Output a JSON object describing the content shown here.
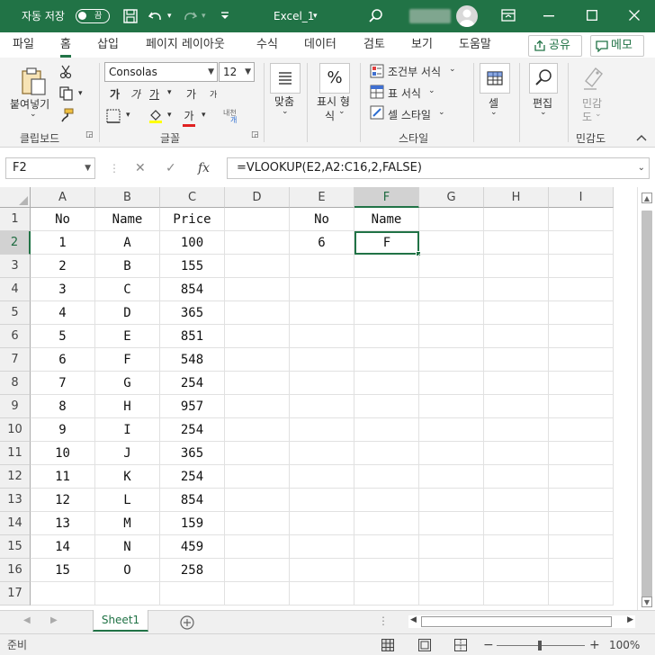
{
  "colors": {
    "accent": "#217346",
    "header_bg": "#f0f0f0",
    "active_border": "#217346"
  },
  "titlebar": {
    "autosave_label": "자동 저장",
    "autosave_state": "끔",
    "doc_title": "Excel_1",
    "icons": [
      "save-icon",
      "undo-icon",
      "redo-icon",
      "customize-icon",
      "search-icon",
      "user-icon",
      "ribbon-options-icon",
      "minimize-icon",
      "maximize-icon",
      "close-icon"
    ]
  },
  "tabs": {
    "items": [
      "파일",
      "홈",
      "삽입",
      "페이지 레이아웃",
      "수식",
      "데이터",
      "검토",
      "보기",
      "도움말"
    ],
    "active": "홈",
    "share_label": "공유",
    "memo_label": "메모"
  },
  "ribbon": {
    "clipboard": {
      "paste_label": "붙여넣기",
      "group": "클립보드"
    },
    "font": {
      "family": "Consolas",
      "size": "12",
      "group": "글꼴",
      "bold": "가",
      "italic": "가",
      "underline": "가",
      "grow": "가",
      "shrink": "가",
      "fill": "가",
      "color": "가",
      "phonetic": "내천"
    },
    "alignment": {
      "label": "맞춤"
    },
    "number": {
      "label_line1": "표시 형",
      "label_line2": "식",
      "symbol": "%"
    },
    "styles": {
      "cond_format": "조건부 서식",
      "table_format": "표 서식",
      "cell_styles": "셀 스타일",
      "group": "스타일"
    },
    "cells": {
      "label": "셀"
    },
    "editing": {
      "label": "편집"
    },
    "sensitivity": {
      "label_line1": "민감",
      "label_line2": "도",
      "group": "민감도"
    }
  },
  "formula_bar": {
    "name_box": "F2",
    "formula": "=VLOOKUP(E2,A2:C16,2,FALSE)"
  },
  "sheet": {
    "columns": [
      "A",
      "B",
      "C",
      "D",
      "E",
      "F",
      "G",
      "H",
      "I"
    ],
    "rows": [
      "1",
      "2",
      "3",
      "4",
      "5",
      "6",
      "7",
      "8",
      "9",
      "10",
      "11",
      "12",
      "13",
      "14",
      "15",
      "16",
      "17"
    ],
    "active_cell": "F2",
    "cells": [
      [
        "No",
        "Name",
        "Price",
        "",
        "No",
        "Name",
        "",
        "",
        ""
      ],
      [
        "1",
        "A",
        "100",
        "",
        "6",
        "F",
        "",
        "",
        ""
      ],
      [
        "2",
        "B",
        "155",
        "",
        "",
        "",
        "",
        "",
        ""
      ],
      [
        "3",
        "C",
        "854",
        "",
        "",
        "",
        "",
        "",
        ""
      ],
      [
        "4",
        "D",
        "365",
        "",
        "",
        "",
        "",
        "",
        ""
      ],
      [
        "5",
        "E",
        "851",
        "",
        "",
        "",
        "",
        "",
        ""
      ],
      [
        "6",
        "F",
        "548",
        "",
        "",
        "",
        "",
        "",
        ""
      ],
      [
        "7",
        "G",
        "254",
        "",
        "",
        "",
        "",
        "",
        ""
      ],
      [
        "8",
        "H",
        "957",
        "",
        "",
        "",
        "",
        "",
        ""
      ],
      [
        "9",
        "I",
        "254",
        "",
        "",
        "",
        "",
        "",
        ""
      ],
      [
        "10",
        "J",
        "365",
        "",
        "",
        "",
        "",
        "",
        ""
      ],
      [
        "11",
        "K",
        "254",
        "",
        "",
        "",
        "",
        "",
        ""
      ],
      [
        "12",
        "L",
        "854",
        "",
        "",
        "",
        "",
        "",
        ""
      ],
      [
        "13",
        "M",
        "159",
        "",
        "",
        "",
        "",
        "",
        ""
      ],
      [
        "14",
        "N",
        "459",
        "",
        "",
        "",
        "",
        "",
        ""
      ],
      [
        "15",
        "O",
        "258",
        "",
        "",
        "",
        "",
        "",
        ""
      ],
      [
        "",
        "",
        "",
        "",
        "",
        "",
        "",
        "",
        ""
      ]
    ]
  },
  "sheet_tabs": {
    "active": "Sheet1"
  },
  "status": {
    "ready": "준비",
    "zoom": "100%"
  }
}
